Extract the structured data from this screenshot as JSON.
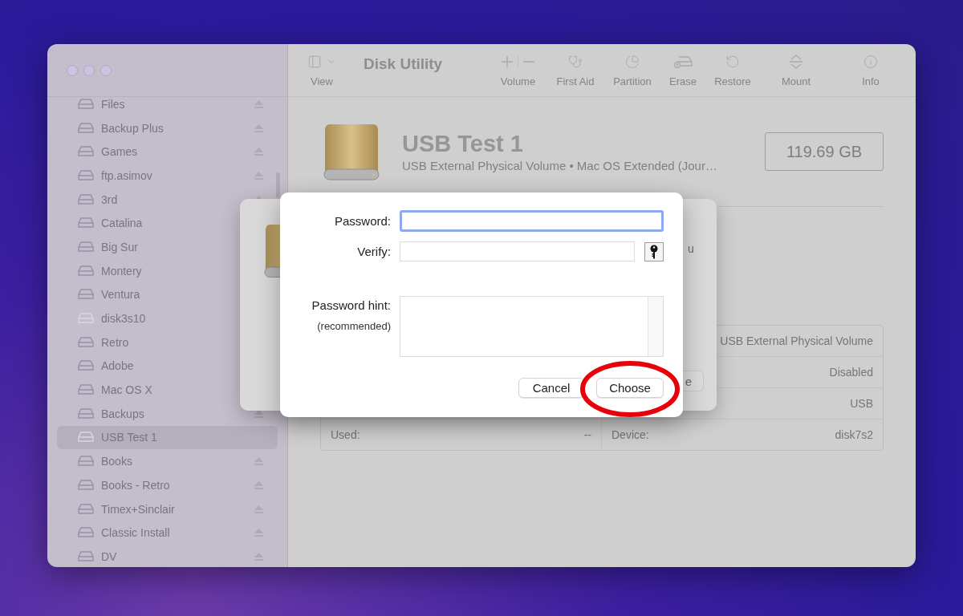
{
  "window": {
    "title": "Disk Utility"
  },
  "sidebar": {
    "items": [
      {
        "label": "Files",
        "eject": true,
        "mounted": true,
        "selected": false
      },
      {
        "label": "Backup Plus",
        "eject": true,
        "mounted": true,
        "selected": false
      },
      {
        "label": "Games",
        "eject": true,
        "mounted": true,
        "selected": false
      },
      {
        "label": "ftp.asimov",
        "eject": true,
        "mounted": true,
        "selected": false
      },
      {
        "label": "3rd",
        "eject": true,
        "mounted": true,
        "selected": false
      },
      {
        "label": "Catalina",
        "eject": false,
        "mounted": true,
        "selected": false
      },
      {
        "label": "Big Sur",
        "eject": false,
        "mounted": true,
        "selected": false
      },
      {
        "label": "Montery",
        "eject": false,
        "mounted": true,
        "selected": false
      },
      {
        "label": "Ventura",
        "eject": false,
        "mounted": true,
        "selected": false
      },
      {
        "label": "disk3s10",
        "eject": false,
        "mounted": false,
        "selected": false
      },
      {
        "label": "Retro",
        "eject": false,
        "mounted": true,
        "selected": false
      },
      {
        "label": "Adobe",
        "eject": false,
        "mounted": true,
        "selected": false
      },
      {
        "label": "Mac OS X",
        "eject": false,
        "mounted": true,
        "selected": false
      },
      {
        "label": "Backups",
        "eject": true,
        "mounted": true,
        "selected": false
      },
      {
        "label": "USB Test 1",
        "eject": false,
        "mounted": false,
        "selected": true
      },
      {
        "label": "Books",
        "eject": true,
        "mounted": true,
        "selected": false
      },
      {
        "label": "Books - Retro",
        "eject": true,
        "mounted": true,
        "selected": false
      },
      {
        "label": "Timex+Sinclair",
        "eject": true,
        "mounted": true,
        "selected": false
      },
      {
        "label": "Classic Install",
        "eject": true,
        "mounted": true,
        "selected": false
      },
      {
        "label": "DV",
        "eject": true,
        "mounted": true,
        "selected": false
      }
    ]
  },
  "toolbar": {
    "view": {
      "label": "View"
    },
    "tools": [
      {
        "kind": "volume",
        "label": "Volume"
      },
      {
        "kind": "first_aid",
        "label": "First Aid"
      },
      {
        "kind": "partition",
        "label": "Partition"
      },
      {
        "kind": "erase",
        "label": "Erase"
      },
      {
        "kind": "restore",
        "label": "Restore"
      },
      {
        "kind": "mount",
        "label": "Mount"
      },
      {
        "kind": "info",
        "label": "Info"
      }
    ]
  },
  "volume": {
    "name": "USB Test 1",
    "subtitle": "USB External Physical Volume • Mac OS Extended (Jour…",
    "capacity": "119.69 GB"
  },
  "info_table": {
    "rows": [
      {
        "right_value": "USB External Physical Volume"
      },
      {
        "right_value": "Disabled"
      },
      {
        "right_value": "USB"
      },
      {
        "left_label": "Used:",
        "left_value": "--",
        "right_label": "Device:",
        "right_value": "disk7s2"
      }
    ]
  },
  "back_sheet": {
    "text": "u",
    "button": "e"
  },
  "dialog": {
    "password": {
      "label": "Password:",
      "focused": true
    },
    "verify": {
      "label": "Verify:"
    },
    "hint": {
      "label": "Password hint:",
      "note": "(recommended)"
    },
    "buttons": [
      {
        "label": "Cancel",
        "highlighted": false
      },
      {
        "label": "Choose",
        "highlighted": true
      }
    ]
  }
}
